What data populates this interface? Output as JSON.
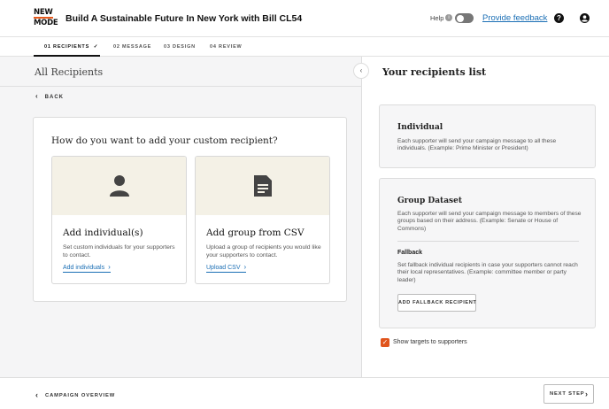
{
  "header": {
    "logo_top": "NEW",
    "logo_bottom": "MODE",
    "title": "Build A Sustainable Future In New York with Bill CL54",
    "help_label": "Help",
    "feedback_label": "Provide feedback"
  },
  "steps": [
    {
      "label": "01 RECIPIENTS",
      "check": "✓"
    },
    {
      "label": "02 MESSAGE"
    },
    {
      "label": "03 DESIGN"
    },
    {
      "label": "04 REVIEW"
    }
  ],
  "left": {
    "title": "All Recipients",
    "back_label": "BACK",
    "question": "How do you want to add your custom recipient?",
    "options": [
      {
        "icon": "person-icon",
        "title": "Add individual(s)",
        "desc": "Set custom individuals for your supporters to contact.",
        "link": "Add individuals"
      },
      {
        "icon": "document-icon",
        "title": "Add group from CSV",
        "desc": "Upload a group of recipients you would like your supporters to contact.",
        "link": "Upload CSV"
      }
    ]
  },
  "right": {
    "title": "Your recipients list",
    "individual": {
      "title": "Individual",
      "desc": "Each supporter will send your campaign message to all these individuals. (Example: Prime Minister or President)"
    },
    "group": {
      "title": "Group Dataset",
      "desc": "Each supporter will send your campaign message to members of these groups based on their address. (Example: Senate or House of Commons)",
      "fallback_title": "Fallback",
      "fallback_desc": "Set fallback individual recipients in case your supporters cannot reach their local representatives. (Example: committee member or party leader)",
      "fallback_button": "ADD FALLBACK RECIPIENT"
    },
    "show_targets_label": "Show targets to supporters",
    "show_targets_checked": true
  },
  "footer": {
    "back_label": "CAMPAIGN OVERVIEW",
    "next_label": "NEXT STEP"
  },
  "colors": {
    "accent": "#e0541c",
    "link": "#1b6fb5",
    "card_top": "#f4f1e6"
  }
}
